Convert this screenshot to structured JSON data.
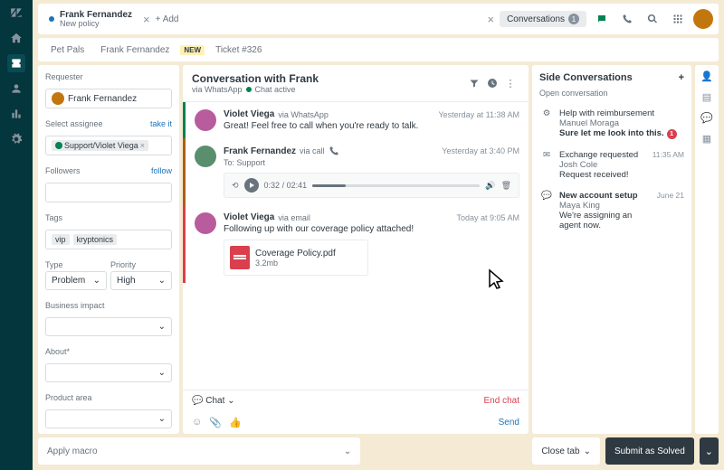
{
  "topbar": {
    "ticket_tab": {
      "name": "Frank Fernandez",
      "sub": "New policy"
    },
    "add_label": "+ Add",
    "conversations": {
      "label": "Conversations",
      "count": "1"
    }
  },
  "breadcrumbs": {
    "a": "Pet Pals",
    "b": "Frank Fernandez",
    "new": "NEW",
    "ticket": "Ticket #326"
  },
  "left": {
    "requester_lbl": "Requester",
    "requester": "Frank Fernandez",
    "assignee_lbl": "Select assignee",
    "takeit": "take it",
    "assignee": "Support/Violet Viega",
    "followers_lbl": "Followers",
    "follow": "follow",
    "tags_lbl": "Tags",
    "tag1": "vip",
    "tag2": "kryptonics",
    "type_lbl": "Type",
    "type": "Problem",
    "prio_lbl": "Priority",
    "prio": "High",
    "biz_lbl": "Business impact",
    "about_lbl": "About*",
    "area_lbl": "Product area"
  },
  "conversation": {
    "title": "Conversation with Frank",
    "via": "via WhatsApp",
    "status": "Chat active",
    "messages": [
      {
        "name": "Violet Viega",
        "via": "via WhatsApp",
        "time": "Yesterday at 11:38 AM",
        "text": "Great! Feel free to call when you're ready to talk."
      },
      {
        "name": "Frank Fernandez",
        "via": "via call",
        "time": "Yesterday at 3:40 PM",
        "to": "To: Support",
        "audio": {
          "time": "0:32 / 02:41"
        }
      },
      {
        "name": "Violet Viega",
        "via": "via email",
        "time": "Today at 9:05 AM",
        "text": "Following up with our coverage policy attached!",
        "file": {
          "name": "Coverage Policy.pdf",
          "size": "3.2mb"
        }
      }
    ],
    "chat_lbl": "Chat",
    "end": "End chat",
    "send": "Send"
  },
  "side": {
    "title": "Side Conversations",
    "open": "Open conversation",
    "items": [
      {
        "title": "Help with reimbursement",
        "name": "Manuel Moraga",
        "status": "Sure let me look into this.",
        "badge": "1",
        "time": ""
      },
      {
        "title": "Exchange requested",
        "name": "Josh Cole",
        "status": "Request received!",
        "time": "11:35 AM"
      },
      {
        "title": "New account setup",
        "name": "Maya King",
        "status": "We're assigning an agent now.",
        "time": "June 21"
      }
    ]
  },
  "footer": {
    "macro": "Apply macro",
    "close": "Close tab",
    "submit": "Submit as Solved"
  }
}
